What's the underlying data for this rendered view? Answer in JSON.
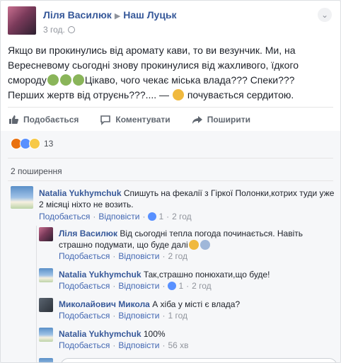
{
  "post": {
    "author": "Ліля Василюк",
    "group": "Наш Луцьк",
    "time": "3 год.",
    "text_1": "Якщо ви прокинулись від аромату кави, то ви везунчик. Ми, на Вересневому сьогодні знову прокинулися від жахливого, їдкого смороду",
    "text_2": "Цікаво, чого чекає міська влада??? Спеки??? Перших жертв від отруєнь???.... —",
    "text_3": " почувається сердитою."
  },
  "actions": {
    "like": "Подобається",
    "comment": "Коментувати",
    "share": "Поширити"
  },
  "reactions": {
    "count": "13"
  },
  "shares": {
    "label": "2 поширення"
  },
  "comments": [
    {
      "author": "Natalia Yukhymchuk",
      "text": "Спишуть на фекалії з Гіркої Полонки,котрих туди уже 2 місяці ніхто не возить.",
      "like": "Подобається",
      "reply": "Відповісти",
      "likes": "1",
      "time": "2 год"
    }
  ],
  "replies": [
    {
      "author": "Ліля Василюк",
      "text": "Від сьогодні тепла погода починається. Навіть страшно подумати, що буде далі",
      "like": "Подобається",
      "reply": "Відповісти",
      "likes": "",
      "time": "2 год"
    },
    {
      "author": "Natalia Yukhymchuk",
      "text": "Так,страшно понюхати,що буде!",
      "like": "Подобається",
      "reply": "Відповісти",
      "likes": "1",
      "time": "2 год"
    },
    {
      "author": "Миколайович Микола",
      "text": "А хіба у місті є влада?",
      "like": "Подобається",
      "reply": "Відповісти",
      "likes": "",
      "time": "1 год"
    },
    {
      "author": "Natalia Yukhymchuk",
      "text": "100%",
      "like": "Подобається",
      "reply": "Відповісти",
      "likes": "",
      "time": "56 хв"
    }
  ],
  "colors": {
    "link": "#365899",
    "muted": "#90949c",
    "like_blue": "#5890ff"
  }
}
